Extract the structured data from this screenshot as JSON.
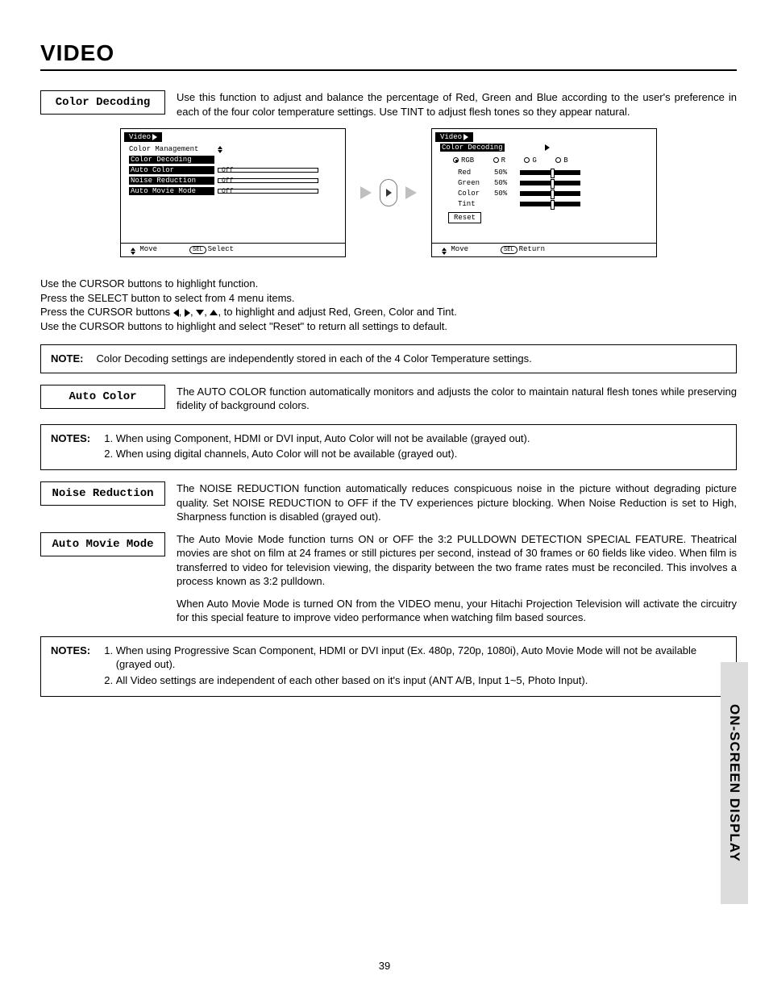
{
  "title": "VIDEO",
  "sidebar": "ON-SCREEN DISPLAY",
  "page_number": "39",
  "labels": {
    "color_decoding": "Color Decoding",
    "auto_color": "Auto Color",
    "noise_reduction": "Noise Reduction",
    "auto_movie_mode": "Auto Movie Mode"
  },
  "desc": {
    "color_decoding": "Use this function to adjust and balance the percentage of Red, Green and Blue according to the user's preference in each of the four color temperature settings.  Use TINT to adjust flesh tones so they appear natural.",
    "auto_color": "The AUTO COLOR function automatically monitors and adjusts the color to maintain natural flesh tones while preserving fidelity of background colors.",
    "noise_reduction": "The NOISE REDUCTION function automatically reduces conspicuous noise in the picture without degrading picture quality.  Set NOISE REDUCTION to OFF if the TV experiences picture blocking.  When Noise Reduction is set to High, Sharpness function is disabled (grayed out).",
    "auto_movie1": "The Auto Movie Mode function turns ON or OFF the 3:2 PULLDOWN DETECTION SPECIAL FEATURE.  Theatrical movies are shot on film at 24 frames or still pictures per second, instead of 30 frames or 60 fields like video.  When film is transferred to video for television viewing, the disparity between the two frame rates must be reconciled.  This involves a process known as 3:2 pulldown.",
    "auto_movie2": "When Auto Movie Mode is turned ON from the VIDEO menu, your Hitachi Projection Television will activate the circuitry for this special feature to improve video performance when watching film based sources."
  },
  "instructions": {
    "l1": "Use the CURSOR buttons to highlight function.",
    "l2": "Press the SELECT button to select from 4 menu items.",
    "l3a": "Press the CURSOR buttons ",
    "l3b": ", to highlight and adjust Red, Green, Color and Tint.",
    "l4": "Use the CURSOR buttons to highlight and select \"Reset\" to return all settings to default."
  },
  "note_label": "NOTE:",
  "notes_label": "NOTES:",
  "note1": "Color Decoding settings are independently stored in each of the 4 Color Temperature settings.",
  "notes2": {
    "i1": "When using Component, HDMI or DVI input, Auto Color will not be available (grayed out).",
    "i2": "When using digital channels, Auto Color will not be available (grayed out)."
  },
  "notes3": {
    "i1": "When using Progressive Scan Component, HDMI or DVI input (Ex. 480p, 720p, 1080i), Auto Movie Mode will not be available (grayed out).",
    "i2": "All Video settings are independent of each other based on it's input (ANT A/B, Input 1~5, Photo Input)."
  },
  "osd1": {
    "title": "Video",
    "items": {
      "cm": "Color Management",
      "cd": "Color Decoding",
      "ac": "Auto Color",
      "nr": "Noise Reduction",
      "amm": "Auto Movie Mode"
    },
    "off": "Off",
    "foot_move": "Move",
    "foot_select": "Select",
    "sel": "SEL"
  },
  "osd2": {
    "title": "Video",
    "sub": "Color Decoding",
    "radios": {
      "rgb": "RGB",
      "r": "R",
      "g": "G",
      "b": "B"
    },
    "rows": {
      "red": "Red",
      "green": "Green",
      "color": "Color",
      "tint": "Tint"
    },
    "pct": "50%",
    "reset": "Reset",
    "foot_move": "Move",
    "foot_return": "Return",
    "sel": "SEL"
  }
}
